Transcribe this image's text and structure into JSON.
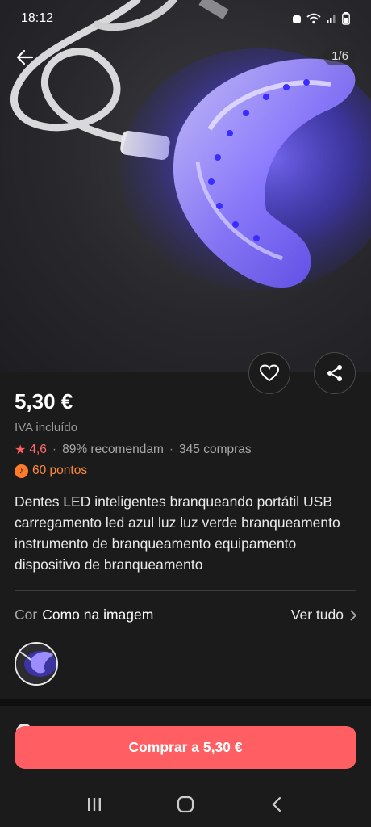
{
  "status_bar": {
    "time": "18:12"
  },
  "gallery": {
    "counter": "1/6"
  },
  "product": {
    "price": "5,30 €",
    "vat_note": "IVA incluído",
    "rating": "4,6",
    "recommend": "89% recomendam",
    "purchases": "345 compras",
    "points": "60 pontos",
    "title": "Dentes LED inteligentes branqueando portátil USB carregamento led azul luz luz verde branqueamento instrumento de branqueamento equipamento dispositivo de branqueamento"
  },
  "variant": {
    "label": "Cor",
    "value": "Como na imagem",
    "see_all": "Ver tudo"
  },
  "buy": {
    "label": "Comprar a 5,30 €"
  },
  "colors": {
    "accent": "#ff5f63",
    "rating": "#ff6a6a",
    "points": "#ff8a3d",
    "background": "#1b1b1b"
  }
}
